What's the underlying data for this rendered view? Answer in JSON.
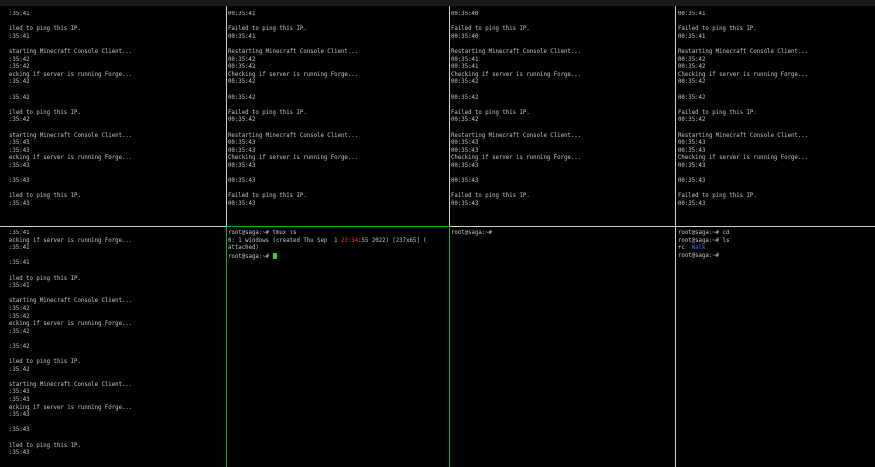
{
  "panes": [
    {
      "id": "p1",
      "lines": [
        ":35:41",
        "",
        "iled to ping this IP.",
        ":35:41",
        "",
        "starting Minecraft Console Client...",
        ":35:42",
        ":35:42",
        "ecking if server is running Forge...",
        ":35:42",
        "",
        ":35:42",
        "",
        "iled to ping this IP.",
        ":35:42",
        "",
        "starting Minecraft Console Client...",
        ":35:43",
        ":35:43",
        "ecking if server is running Forge...",
        ":35:43",
        "",
        ":35:43",
        "",
        "iled to ping this IP.",
        ":35:43"
      ]
    },
    {
      "id": "p2",
      "lines": [
        "00:35:41",
        "",
        "Failed to ping this IP.",
        "00:35:41",
        "",
        "Restarting Minecraft Console Client...",
        "00:35:42",
        "00:35:42",
        "Checking if server is running Forge...",
        "00:35:42",
        "",
        "00:35:42",
        "",
        "Failed to ping this IP.",
        "00:35:42",
        "",
        "Restarting Minecraft Console Client...",
        "00:35:43",
        "00:35:43",
        "Checking if server is running Forge...",
        "00:35:43",
        "",
        "00:35:43",
        "",
        "Failed to ping this IP.",
        "00:35:43"
      ]
    },
    {
      "id": "p3",
      "lines": [
        "00:35:40",
        "",
        "Failed to ping this IP.",
        "00:35:40",
        "",
        "Restarting Minecraft Console Client...",
        "00:35:41",
        "00:35:41",
        "Checking if server is running Forge...",
        "00:35:42",
        "",
        "00:35:42",
        "",
        "Failed to ping this IP.",
        "00:35:42",
        "",
        "Restarting Minecraft Console Client...",
        "00:35:43",
        "00:35:43",
        "Checking if server is running Forge...",
        "00:35:43",
        "",
        "00:35:43",
        "",
        "Failed to ping this IP.",
        "00:35:43"
      ]
    },
    {
      "id": "p4",
      "lines": [
        "00:35:41",
        "",
        "Failed to ping this IP.",
        "00:35:41",
        "",
        "Restarting Minecraft Console Client...",
        "00:35:42",
        "00:35:42",
        "Checking if server is running Forge...",
        "00:35:42",
        "",
        "00:35:42",
        "",
        "Failed to ping this IP.",
        "00:35:42",
        "",
        "Restarting Minecraft Console Client...",
        "00:35:43",
        "00:35:43",
        "Checking if server is running Forge...",
        "00:35:43",
        "",
        "00:35:43",
        "",
        "Failed to ping this IP.",
        "00:35:43"
      ]
    },
    {
      "id": "p5",
      "lines": [
        ":35:41",
        "ecking if server is running Forge...",
        ":35:41",
        "",
        ":35:41",
        "",
        "iled to ping this IP.",
        ":35:41",
        "",
        "starting Minecraft Console Client...",
        ":35:42",
        ":35:42",
        "ecking if server is running Forge...",
        ":35:42",
        "",
        ":35:42",
        "",
        "iled to ping this IP.",
        ":35:42",
        "",
        "starting Minecraft Console Client...",
        ":35:43",
        ":35:43",
        "ecking if server is running Forge...",
        ":35:43",
        "",
        ":35:43",
        "",
        "iled to ping this IP.",
        ":35:43"
      ]
    }
  ],
  "pane6": {
    "prompt1": "root@saga:~# tmux ls",
    "ls_pre": "0: 1 windows (created Thu Sep  1 ",
    "ls_red": "23:54",
    "ls_post": ":55 2022) [237x65] (",
    "ls_attached": "attached)",
    "prompt2": "root@saga:~# "
  },
  "pane7": {
    "prompt": "root@saga:~#"
  },
  "pane8": {
    "line1": "root@saga:~# cd",
    "line2": "root@saga:~# ls",
    "line3_pre": "+c  ",
    "line3_blue": "Walk",
    "line4": "root@saga:~#"
  },
  "colors": {
    "separator": "#cfcfcf",
    "active_separator": "#1fa81f",
    "cursor": "#22dd22",
    "text": "#c8c8c8"
  }
}
